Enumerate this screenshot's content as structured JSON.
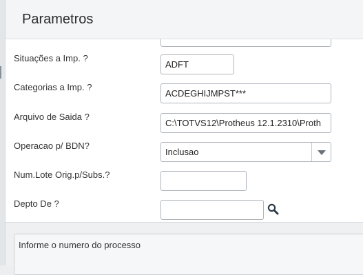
{
  "dialog": {
    "title": "Parametros"
  },
  "form": {
    "fields": [
      {
        "label": "Situações a Imp. ?",
        "value": "ADFT"
      },
      {
        "label": "Categorias a Imp. ?",
        "value": "ACDEGHIJMPST***"
      },
      {
        "label": "Arquivo de Saida ?",
        "value": "C:\\TOTVS12\\Protheus 12.1.2310\\Proth"
      },
      {
        "label": "Operacao p/ BDN?",
        "value": "Inclusao",
        "icon": "chevron-down-icon"
      },
      {
        "label": "Num.Lote Orig.p/Subs.?",
        "value": ""
      },
      {
        "label": "Depto De ?",
        "value": "",
        "icon": "search-icon"
      }
    ]
  },
  "help": {
    "text": "Informe o numero do processo"
  }
}
